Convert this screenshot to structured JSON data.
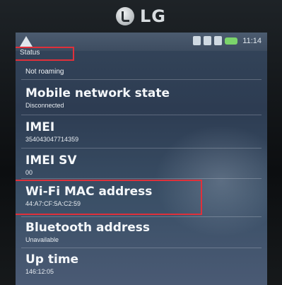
{
  "device": {
    "brand": "LG"
  },
  "status_bar": {
    "time": "11:14"
  },
  "screen": {
    "title": "Status",
    "caption": "Not roaming",
    "items": [
      {
        "label": "Mobile network state",
        "value": "Disconnected"
      },
      {
        "label": "IMEI",
        "value": "354043047714359"
      },
      {
        "label": "IMEI SV",
        "value": "00"
      },
      {
        "label": "Wi-Fi MAC address",
        "value": "44:A7:CF:5A:C2:59"
      },
      {
        "label": "Bluetooth address",
        "value": "Unavailable"
      },
      {
        "label": "Up time",
        "value": "146:12:05"
      }
    ]
  },
  "colors": {
    "highlight": "#e0303a",
    "screen_bg": "#34455a"
  }
}
